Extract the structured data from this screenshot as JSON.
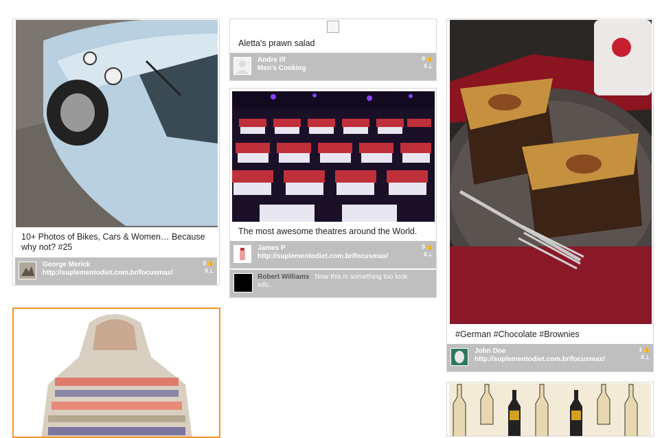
{
  "cards": {
    "car": {
      "caption": "10+ Photos of Bikes, Cars & Women… Because why not? #25",
      "user": "George Merick",
      "link": "http://suplementodiet.com.br/focusmax/",
      "likes": "0",
      "dislikes": "0"
    },
    "salad": {
      "caption": "Aletta's prawn salad",
      "user": "Andre Ilf",
      "board": "Men's Cooking",
      "likes": "0",
      "dislikes": "0"
    },
    "theatre": {
      "caption": "The most awesome theatres around the World.",
      "user": "James P",
      "link": "http://suplementodiet.com.br/focusmax/",
      "likes": "0",
      "dislikes": "0",
      "comment_user": "Robert Williams",
      "comment_text": "Now this is something too look info.."
    },
    "brownies": {
      "caption": "#German #Chocolate #Brownies",
      "user": "John Doe",
      "link": "http://suplementodiet.com.br/focusmax/",
      "likes": "1",
      "dislikes": "0"
    }
  },
  "icons": {
    "like": "thumbs-up-icon",
    "dislike": "thumbs-down-icon"
  },
  "colors": {
    "meta_bar": "#bfbfbf",
    "selected_border": "#f7931e"
  }
}
